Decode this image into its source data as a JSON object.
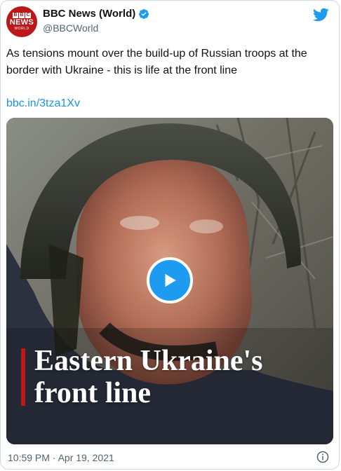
{
  "account": {
    "display_name": "BBC News (World)",
    "handle": "@BBCWorld",
    "avatar": {
      "letters": [
        "B",
        "B",
        "C"
      ],
      "line1": "NEWS",
      "line2": "WORLD"
    },
    "verified_icon": "verified-badge-icon",
    "brand_color": "#bb1919"
  },
  "tweet": {
    "text": "As tensions mount over the build-up of Russian troops at the border with Ukraine - this is life at the front line",
    "link": "bbc.in/3tza1Xv",
    "link_color": "#1b95e0"
  },
  "media": {
    "type": "video",
    "caption_line1": "Eastern Ukraine's",
    "caption_line2": "front line",
    "play_icon": "play-icon",
    "accent_color": "#1d9bf0"
  },
  "footer": {
    "timestamp": "10:59 PM · Apr 19, 2021",
    "info_icon": "info-icon"
  },
  "app": {
    "logo_icon": "twitter-bird-icon",
    "logo_color": "#1d9bf0"
  }
}
